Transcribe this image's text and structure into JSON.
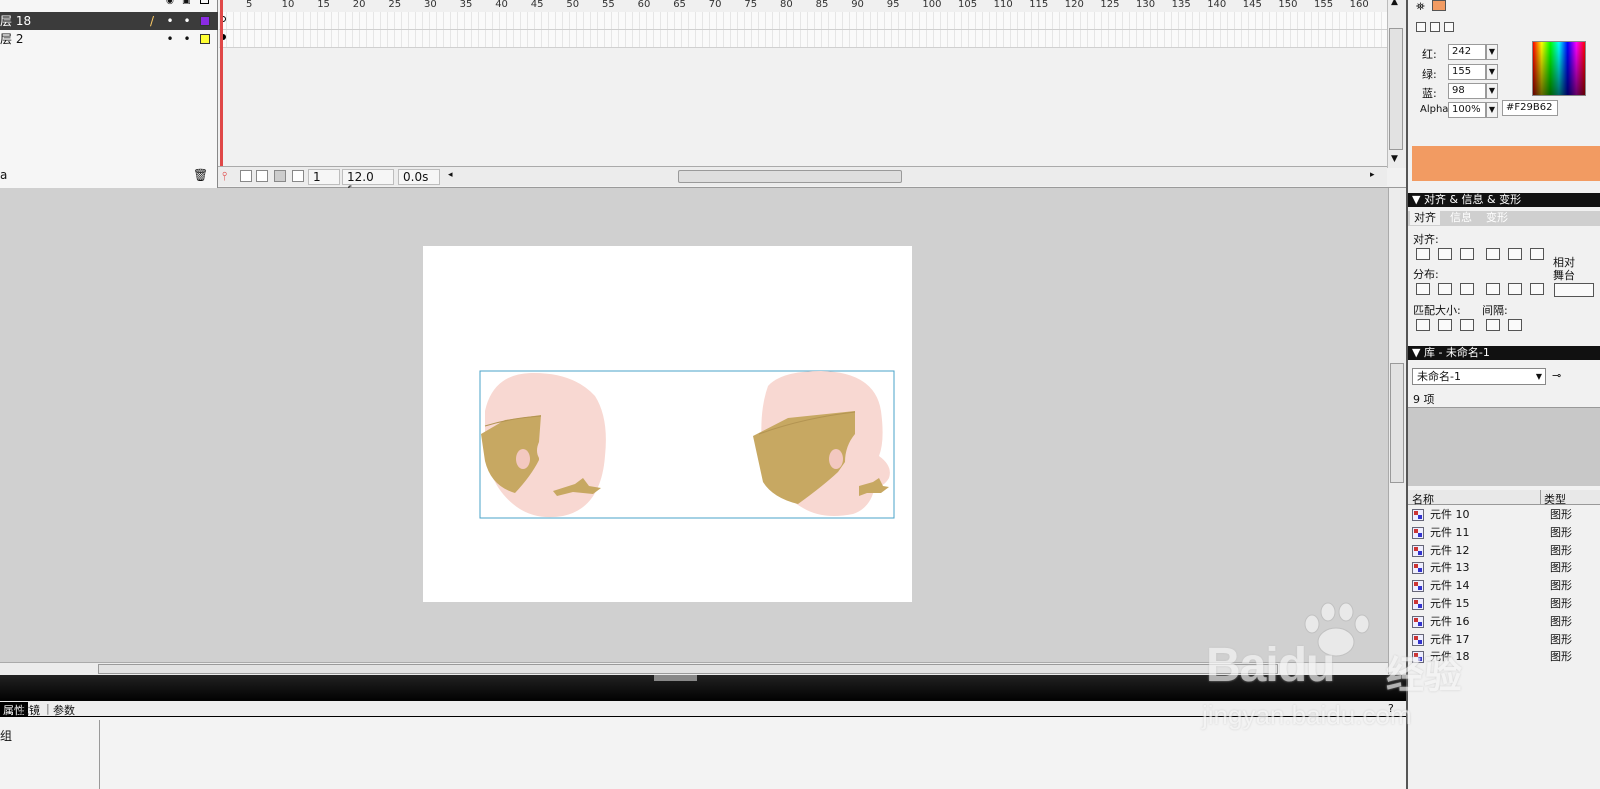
{
  "timeline": {
    "layers": [
      {
        "name": "层 18",
        "color": "#8a2be2",
        "selected": true
      },
      {
        "name": "层 2",
        "color": "#ffff33",
        "selected": false
      }
    ],
    "ruler_ticks": [
      "5",
      "10",
      "15",
      "20",
      "25",
      "30",
      "35",
      "40",
      "45",
      "50",
      "55",
      "60",
      "65",
      "70",
      "75",
      "80",
      "85",
      "90",
      "95",
      "100",
      "105",
      "110",
      "115",
      "120",
      "125",
      "130",
      "135",
      "140",
      "145",
      "150",
      "155",
      "160"
    ],
    "current_frame": "1",
    "fps": "12.0 fps",
    "elapsed": "0.0s"
  },
  "color_mixer": {
    "red_label": "红:",
    "red_value": "242",
    "green_label": "绿:",
    "green_value": "155",
    "blue_label": "蓝:",
    "blue_value": "98",
    "alpha_label": "Alpha:",
    "alpha_value": "100%",
    "hex_value": "#F29B62",
    "fill_color": "#f29b62"
  },
  "align_panel": {
    "header": "▼ 对齐 & 信息 & 变形",
    "tabs": [
      "对齐",
      "信息",
      "变形"
    ],
    "align_label": "对齐:",
    "distribute_label": "分布:",
    "match_size_label": "匹配大小:",
    "spacing_label": "间隔:",
    "relative_label_1": "相对",
    "relative_label_2": "舞台"
  },
  "library": {
    "header": "▼ 库 - 未命名-1",
    "document": "未命名-1",
    "count": "9 项",
    "col_name": "名称",
    "col_type": "类型",
    "items": [
      {
        "name": "元件 10",
        "type": "图形"
      },
      {
        "name": "元件 11",
        "type": "图形"
      },
      {
        "name": "元件 12",
        "type": "图形"
      },
      {
        "name": "元件 13",
        "type": "图形"
      },
      {
        "name": "元件 14",
        "type": "图形"
      },
      {
        "name": "元件 15",
        "type": "图形"
      },
      {
        "name": "元件 16",
        "type": "图形"
      },
      {
        "name": "元件 17",
        "type": "图形"
      },
      {
        "name": "元件 18",
        "type": "图形"
      }
    ]
  },
  "properties": {
    "tabs": [
      "属性",
      "滤镜",
      "参数"
    ],
    "group_label": "组"
  },
  "colors": {
    "face": "#f8d8d2",
    "hair": "#c7a862",
    "selection": "#4aa3c8"
  },
  "watermark": {
    "brand": "Bai",
    "brand2": "du",
    "cn": "经验",
    "url": "jingyan.baidu.com"
  }
}
